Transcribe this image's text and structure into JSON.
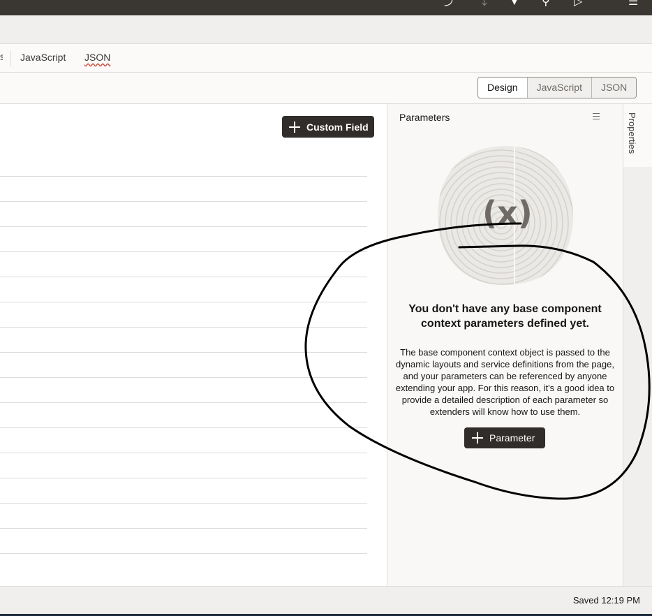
{
  "tabs": {
    "truncated": "s",
    "javascript": "JavaScript",
    "json": "JSON"
  },
  "view_toggle": {
    "design": "Design",
    "javascript": "JavaScript",
    "json": "JSON",
    "selected": "Design"
  },
  "main": {
    "custom_field_label": "Custom Field"
  },
  "parameters_panel": {
    "title": "Parameters",
    "illustration_glyph": "(x)",
    "empty_title": "You don't have any base component context parameters defined yet.",
    "empty_description": "The base component context object is passed to the dynamic layouts and service definitions from the page, and your parameters can be referenced by anyone extending your app. For this reason, it's a good idea to provide a detailed description of each parameter so extenders will know how to use them.",
    "add_parameter_label": "Parameter"
  },
  "sidebar": {
    "properties_label": "Properties"
  },
  "status": {
    "saved_text": "Saved 12:19 PM"
  },
  "icons": {
    "top_1": "undo-icon",
    "top_2": "redo-icon",
    "top_3": "download-icon",
    "top_4": "search-icon",
    "top_5": "run-icon",
    "top_6": "hamburger-menu-icon",
    "custom_field_icon": "plus-icon",
    "parameter_icon": "plus-icon",
    "panel_menu_icon": "hamburger-menu-icon"
  },
  "colors": {
    "topbar": "#3a3632",
    "primary_button": "#312d2a",
    "panel_background": "#f9f8f7",
    "annotation_ink": "#000000"
  }
}
